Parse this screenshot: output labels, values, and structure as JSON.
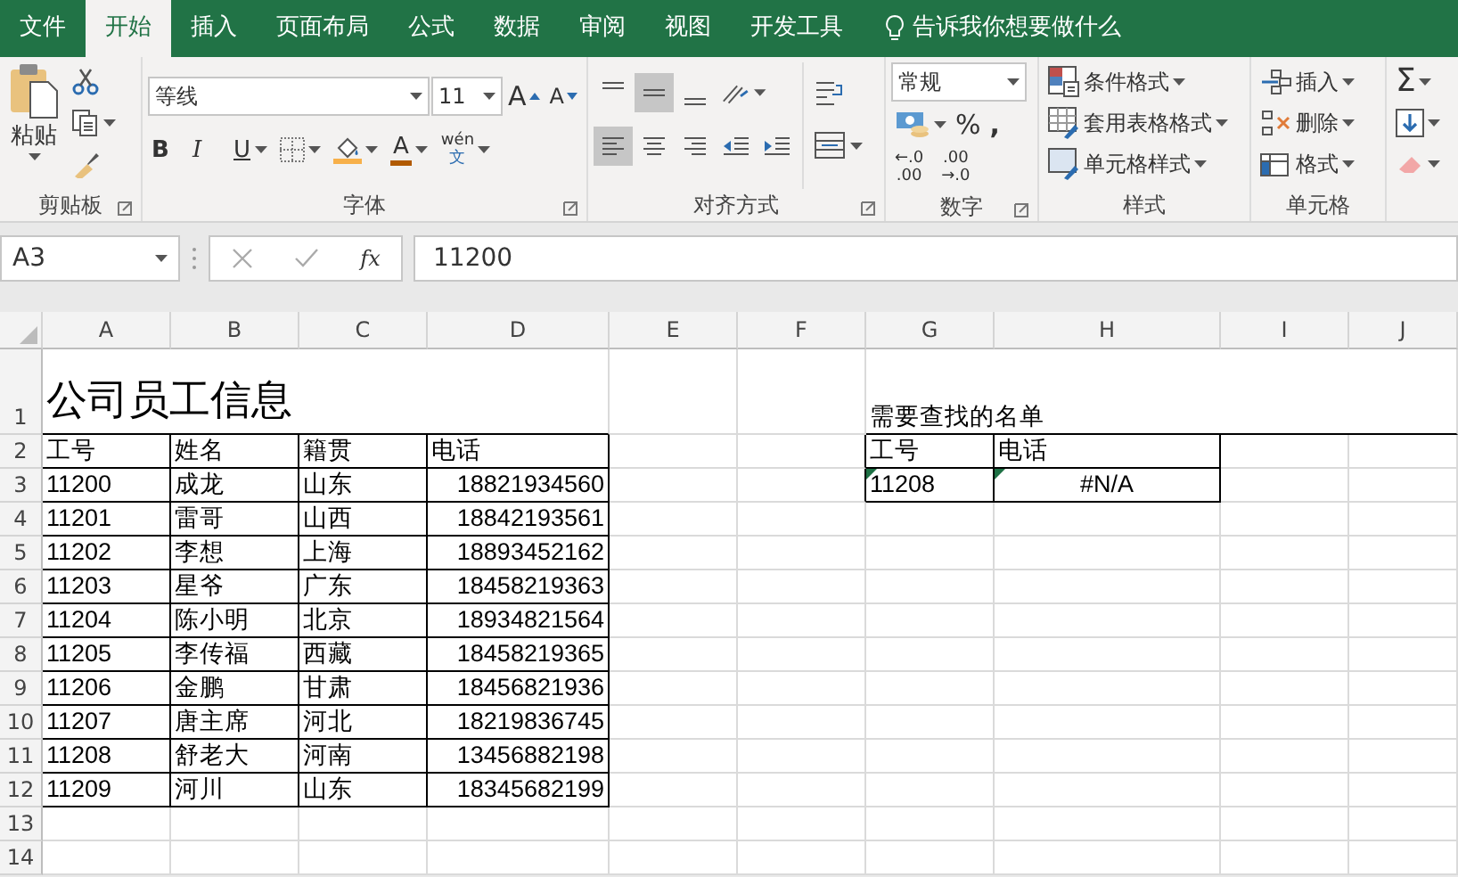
{
  "tabs": [
    {
      "label": "文件",
      "selected": false
    },
    {
      "label": "开始",
      "selected": true
    },
    {
      "label": "插入",
      "selected": false
    },
    {
      "label": "页面布局",
      "selected": false
    },
    {
      "label": "公式",
      "selected": false
    },
    {
      "label": "数据",
      "selected": false
    },
    {
      "label": "审阅",
      "selected": false
    },
    {
      "label": "视图",
      "selected": false
    },
    {
      "label": "开发工具",
      "selected": false
    }
  ],
  "tell_me": "告诉我你想要做什么",
  "ribbon": {
    "clipboard": {
      "label": "剪贴板",
      "paste": "粘贴"
    },
    "font": {
      "label": "字体",
      "font_name": "等线",
      "font_size": "11",
      "grow": "A",
      "shrink": "A",
      "bold": "B",
      "italic": "I",
      "underline": "U",
      "font_color": "A",
      "phonetic_top": "wén",
      "phonetic_bottom": "文"
    },
    "alignment": {
      "label": "对齐方式",
      "rows": [
        [
          {
            "kind": "top",
            "selected": false
          },
          {
            "kind": "middle",
            "selected": true
          },
          {
            "kind": "bottom",
            "selected": false
          },
          {
            "kind": "orientation",
            "selected": false
          }
        ],
        [
          {
            "kind": "left",
            "selected": true
          },
          {
            "kind": "center",
            "selected": false
          },
          {
            "kind": "right",
            "selected": false
          },
          {
            "kind": "outdent",
            "selected": false
          },
          {
            "kind": "indent",
            "selected": false
          }
        ]
      ],
      "side": [
        {
          "kind": "wrap",
          "selected": false
        },
        {
          "kind": "merge",
          "selected": false
        }
      ]
    },
    "number": {
      "label": "数字",
      "format": "常规",
      "percent": "%",
      "comma": ",",
      "decimals": [
        {
          "top": "←.0",
          "bottom": ".00"
        },
        {
          "top": ".00",
          "bottom": "→.0"
        }
      ]
    },
    "styles": {
      "label": "样式",
      "items": [
        {
          "kind": "conditional",
          "label": "条件格式"
        },
        {
          "kind": "table",
          "label": "套用表格格式"
        },
        {
          "kind": "cellstyle",
          "label": "单元格样式"
        }
      ]
    },
    "cells": {
      "label": "单元格",
      "items": [
        {
          "kind": "insert",
          "label": "插入"
        },
        {
          "kind": "delete",
          "label": "删除"
        },
        {
          "kind": "format",
          "label": "格式"
        }
      ]
    },
    "editing": {
      "items": [
        {
          "kind": "sum",
          "symbol": "Σ"
        },
        {
          "kind": "fill"
        },
        {
          "kind": "clear"
        }
      ]
    }
  },
  "formula_bar": {
    "name_box": "A3",
    "fx": "fx",
    "formula": "11200"
  },
  "sheet": {
    "columns": [
      "A",
      "B",
      "C",
      "D",
      "E",
      "F",
      "G",
      "H",
      "I",
      "J"
    ],
    "rows": [
      {
        "number": "1",
        "cells": [
          {
            "text": "公司员工信息",
            "kind": "title",
            "bordered": false,
            "error_indicator": false
          },
          {
            "text": "",
            "kind": "empty"
          },
          {
            "text": "",
            "kind": "empty"
          },
          {
            "text": "",
            "kind": "empty"
          },
          {
            "text": "",
            "kind": "empty"
          },
          {
            "text": "",
            "kind": "empty"
          },
          {
            "text": "需要查找的名单",
            "kind": "text",
            "bordered": false,
            "error_indicator": false
          }
        ]
      },
      {
        "number": "2",
        "cells": [
          {
            "text": "工号",
            "kind": "text",
            "bordered": true,
            "error_indicator": false
          },
          {
            "text": "姓名",
            "kind": "text",
            "bordered": true,
            "error_indicator": false
          },
          {
            "text": "籍贯",
            "kind": "text",
            "bordered": true,
            "error_indicator": false
          },
          {
            "text": "电话",
            "kind": "text",
            "bordered": true,
            "error_indicator": false
          },
          {
            "text": "",
            "kind": "empty"
          },
          {
            "text": "",
            "kind": "empty"
          },
          {
            "text": "工号",
            "kind": "text",
            "bordered": true,
            "error_indicator": false
          },
          {
            "text": "电话",
            "kind": "text",
            "bordered": true,
            "error_indicator": false
          }
        ]
      },
      {
        "number": "3",
        "cells": [
          {
            "text": "11200",
            "kind": "text",
            "bordered": true,
            "error_indicator": false
          },
          {
            "text": "成龙",
            "kind": "text",
            "bordered": true,
            "error_indicator": false
          },
          {
            "text": "山东",
            "kind": "text",
            "bordered": true,
            "error_indicator": false
          },
          {
            "text": "18821934560",
            "kind": "number",
            "bordered": true,
            "error_indicator": false
          },
          {
            "text": "",
            "kind": "empty"
          },
          {
            "text": "",
            "kind": "empty"
          },
          {
            "text": "11208",
            "kind": "text",
            "bordered": true,
            "error_indicator": true
          },
          {
            "text": "#N/A",
            "kind": "error",
            "bordered": true,
            "error_indicator": true
          }
        ]
      },
      {
        "number": "4",
        "cells": [
          {
            "text": "11201",
            "kind": "text",
            "bordered": true,
            "error_indicator": false
          },
          {
            "text": "雷哥",
            "kind": "text",
            "bordered": true,
            "error_indicator": false
          },
          {
            "text": "山西",
            "kind": "text",
            "bordered": true,
            "error_indicator": false
          },
          {
            "text": "18842193561",
            "kind": "number",
            "bordered": true,
            "error_indicator": false
          }
        ]
      },
      {
        "number": "5",
        "cells": [
          {
            "text": "11202",
            "kind": "text",
            "bordered": true,
            "error_indicator": false
          },
          {
            "text": "李想",
            "kind": "text",
            "bordered": true,
            "error_indicator": false
          },
          {
            "text": "上海",
            "kind": "text",
            "bordered": true,
            "error_indicator": false
          },
          {
            "text": "18893452162",
            "kind": "number",
            "bordered": true,
            "error_indicator": false
          }
        ]
      },
      {
        "number": "6",
        "cells": [
          {
            "text": "11203",
            "kind": "text",
            "bordered": true,
            "error_indicator": false
          },
          {
            "text": "星爷",
            "kind": "text",
            "bordered": true,
            "error_indicator": false
          },
          {
            "text": "广东",
            "kind": "text",
            "bordered": true,
            "error_indicator": false
          },
          {
            "text": "18458219363",
            "kind": "number",
            "bordered": true,
            "error_indicator": false
          }
        ]
      },
      {
        "number": "7",
        "cells": [
          {
            "text": "11204",
            "kind": "text",
            "bordered": true,
            "error_indicator": false
          },
          {
            "text": "陈小明",
            "kind": "text",
            "bordered": true,
            "error_indicator": false
          },
          {
            "text": "北京",
            "kind": "text",
            "bordered": true,
            "error_indicator": false
          },
          {
            "text": "18934821564",
            "kind": "number",
            "bordered": true,
            "error_indicator": false
          }
        ]
      },
      {
        "number": "8",
        "cells": [
          {
            "text": "11205",
            "kind": "text",
            "bordered": true,
            "error_indicator": false
          },
          {
            "text": "李传福",
            "kind": "text",
            "bordered": true,
            "error_indicator": false
          },
          {
            "text": "西藏",
            "kind": "text",
            "bordered": true,
            "error_indicator": false
          },
          {
            "text": "18458219365",
            "kind": "number",
            "bordered": true,
            "error_indicator": false
          }
        ]
      },
      {
        "number": "9",
        "cells": [
          {
            "text": "11206",
            "kind": "text",
            "bordered": true,
            "error_indicator": false
          },
          {
            "text": "金鹏",
            "kind": "text",
            "bordered": true,
            "error_indicator": false
          },
          {
            "text": "甘肃",
            "kind": "text",
            "bordered": true,
            "error_indicator": false
          },
          {
            "text": "18456821936",
            "kind": "number",
            "bordered": true,
            "error_indicator": false
          }
        ]
      },
      {
        "number": "10",
        "cells": [
          {
            "text": "11207",
            "kind": "text",
            "bordered": true,
            "error_indicator": false
          },
          {
            "text": "唐主席",
            "kind": "text",
            "bordered": true,
            "error_indicator": false
          },
          {
            "text": "河北",
            "kind": "text",
            "bordered": true,
            "error_indicator": false
          },
          {
            "text": "18219836745",
            "kind": "number",
            "bordered": true,
            "error_indicator": false
          }
        ]
      },
      {
        "number": "11",
        "cells": [
          {
            "text": "11208",
            "kind": "text",
            "bordered": true,
            "error_indicator": false
          },
          {
            "text": "舒老大",
            "kind": "text",
            "bordered": true,
            "error_indicator": false
          },
          {
            "text": "河南",
            "kind": "text",
            "bordered": true,
            "error_indicator": false
          },
          {
            "text": "13456882198",
            "kind": "number",
            "bordered": true,
            "error_indicator": false
          }
        ]
      },
      {
        "number": "12",
        "cells": [
          {
            "text": "11209",
            "kind": "text",
            "bordered": true,
            "error_indicator": false
          },
          {
            "text": "河川",
            "kind": "text",
            "bordered": true,
            "error_indicator": false
          },
          {
            "text": "山东",
            "kind": "text",
            "bordered": true,
            "error_indicator": false
          },
          {
            "text": "18345682199",
            "kind": "number",
            "bordered": true,
            "error_indicator": false
          }
        ]
      },
      {
        "number": "13",
        "cells": []
      },
      {
        "number": "14",
        "cells": []
      }
    ]
  }
}
